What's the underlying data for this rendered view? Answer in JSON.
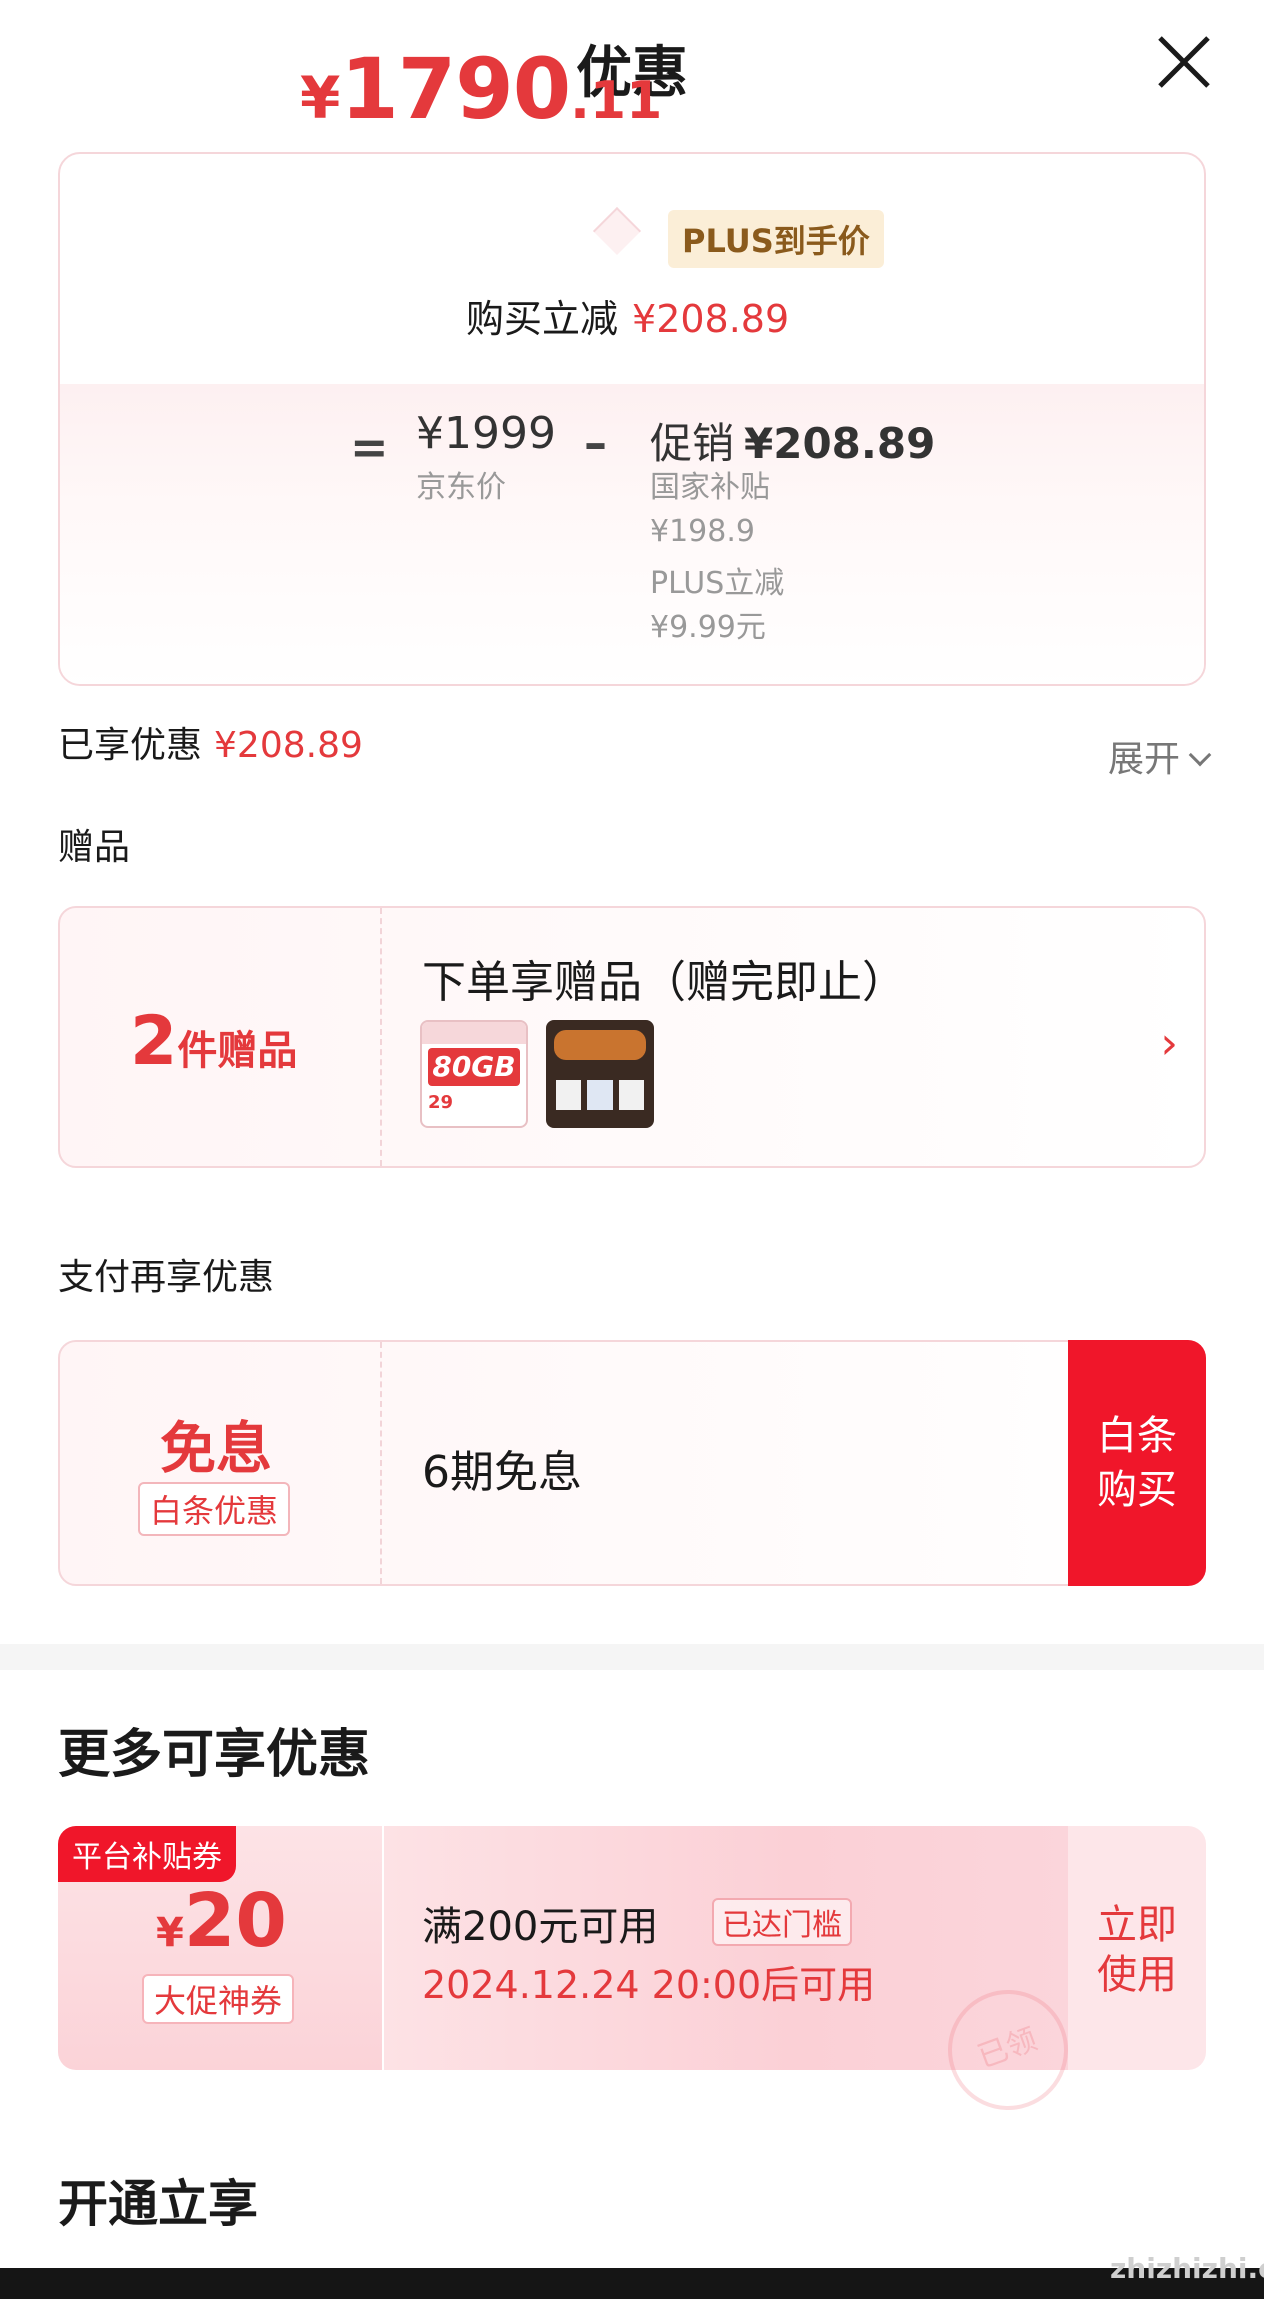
{
  "header": {
    "title": "优惠"
  },
  "price_card": {
    "currency": "¥",
    "price_int": "1790",
    "price_dec": ".11",
    "plus_label": "PLUS到手价",
    "buy_reduce_label": "购买立减",
    "buy_reduce_amount": "¥208.89",
    "equals": "=",
    "jd_price": "¥1999",
    "jd_price_label": "京东价",
    "minus": "–",
    "promo_label": "促销",
    "promo_amount": "¥208.89",
    "details": [
      "国家补贴",
      "¥198.9",
      "PLUS立减",
      "¥9.99元"
    ]
  },
  "saved": {
    "label": "已享优惠",
    "amount": "¥208.89",
    "expand_label": "展开"
  },
  "gifts": {
    "section_label": "赠品",
    "count": "2",
    "count_unit": "件赠品",
    "title": "下单享赠品（赠完即止）",
    "thumb1_text": "80GB",
    "thumb1_sub": "29"
  },
  "payment": {
    "section_label": "支付再享优惠",
    "free_interest": "免息",
    "baitiao_badge": "白条优惠",
    "installments": "6期免息",
    "buy_button": [
      "白条",
      "购买"
    ]
  },
  "more": {
    "title": "更多可享优惠",
    "coupon": {
      "platform_tag": "平台补贴券",
      "currency": "¥",
      "amount": "20",
      "kind": "大促神券",
      "condition": "满200元可用",
      "reached": "已达门槛",
      "time": "2024.12.24 20:00后可用",
      "use_button": [
        "立即",
        "使用"
      ],
      "stamp": "已领"
    }
  },
  "open_section": {
    "title": "开通立享"
  },
  "watermark": "zhizhizhi.com",
  "colors": {
    "accent": "#e4393c",
    "button": "#f0162a",
    "plus_bg": "#fbeed7"
  }
}
